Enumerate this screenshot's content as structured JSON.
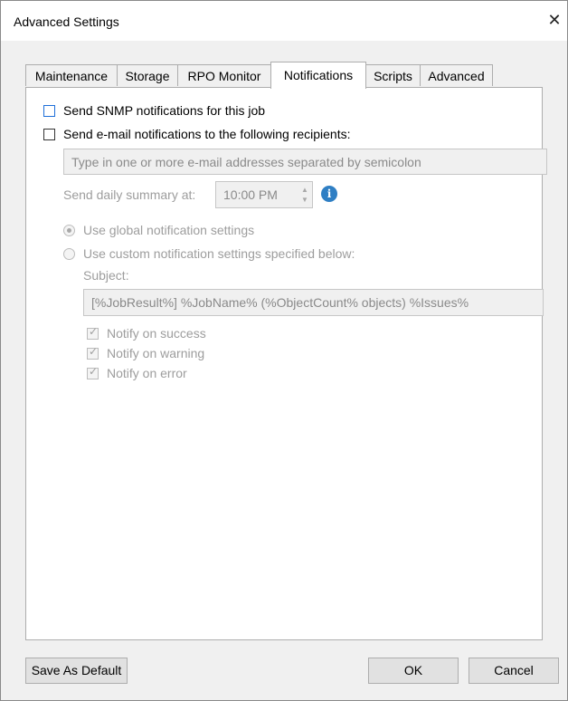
{
  "window": {
    "title": "Advanced Settings"
  },
  "tabs": [
    "Maintenance",
    "Storage",
    "RPO Monitor",
    "Notifications",
    "Scripts",
    "Advanced"
  ],
  "active_tab": "Notifications",
  "snmp": {
    "label": "Send SNMP notifications for this job",
    "checked": false
  },
  "email": {
    "label": "Send e-mail notifications to the following recipients:",
    "checked": false,
    "recipients_placeholder": "Type in one or more e-mail addresses separated by semicolon"
  },
  "daily_summary": {
    "label": "Send daily summary at:",
    "time": "10:00 PM"
  },
  "notification_mode": {
    "global_label": "Use global notification settings",
    "custom_label": "Use custom notification settings specified below:",
    "selected": "global"
  },
  "subject": {
    "label": "Subject:",
    "value": "[%JobResult%] %JobName% (%ObjectCount% objects) %Issues%"
  },
  "notify": [
    {
      "label": "Notify on success",
      "checked": true
    },
    {
      "label": "Notify on warning",
      "checked": true
    },
    {
      "label": "Notify on error",
      "checked": true
    }
  ],
  "buttons": {
    "save_default": "Save As Default",
    "ok": "OK",
    "cancel": "Cancel"
  },
  "colors": {
    "info_icon": "#2f7fc4",
    "focus_border": "#1e6fd9",
    "dialog_bg": "#f0f0f0"
  }
}
